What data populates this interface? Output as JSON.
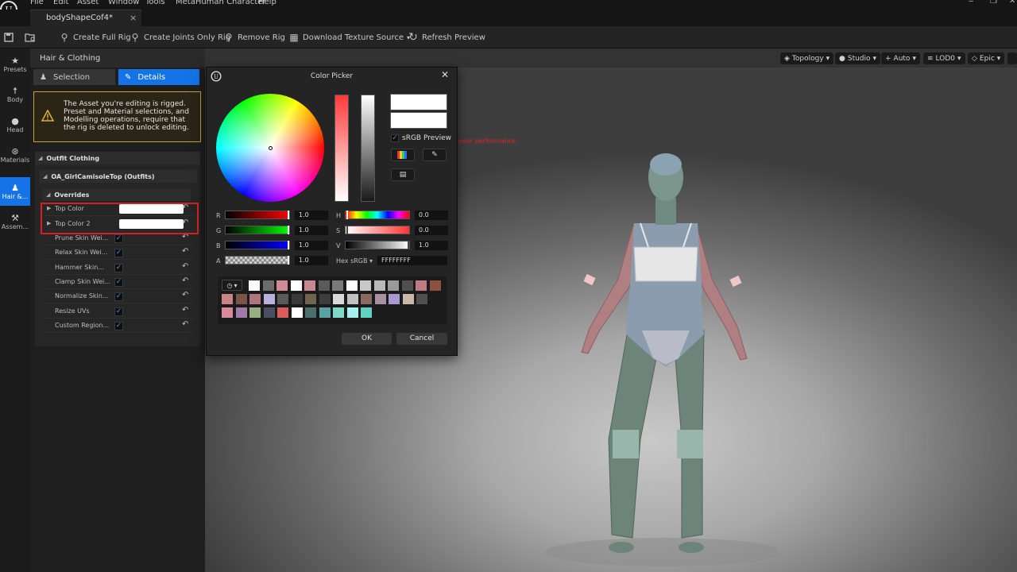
{
  "menu": [
    "File",
    "Edit",
    "Asset",
    "Window",
    "Tools",
    "MetaHuman Character",
    "Help"
  ],
  "tab": {
    "title": "bodyShapeCof4*",
    "close": "×"
  },
  "toolbar": {
    "create_full_rig": "Create Full Rig",
    "create_joints_rig": "Create Joints Only Rig",
    "remove_rig": "Remove Rig",
    "download_texture": "Download Texture Source",
    "refresh_preview": "Refresh Preview"
  },
  "rail": [
    {
      "label": "Presets",
      "icon": "star-icon"
    },
    {
      "label": "Body",
      "icon": "body-icon"
    },
    {
      "label": "Head",
      "icon": "head-icon"
    },
    {
      "label": "Materials",
      "icon": "materials-icon"
    },
    {
      "label": "Hair &...",
      "icon": "hair-icon"
    },
    {
      "label": "Assem...",
      "icon": "hammer-icon"
    }
  ],
  "panel": {
    "title": "Hair & Clothing",
    "seg_selection": "Selection",
    "seg_details": "Details",
    "warning": "The Asset you're editing is rigged. Preset and Material selections, and Modelling operations, require that the rig is deleted to unlock editing.",
    "section_outfit": "Outfit Clothing",
    "section_item": "OA_GirlCamisoleTop (Outfits)",
    "section_overrides": "Overrides",
    "props": [
      {
        "label": "Top Color",
        "kind": "color"
      },
      {
        "label": "Top Color 2",
        "kind": "color"
      },
      {
        "label": "Prune Skin Wei...",
        "kind": "check"
      },
      {
        "label": "Relax Skin Wei...",
        "kind": "check"
      },
      {
        "label": "Hammer Skin...",
        "kind": "check"
      },
      {
        "label": "Clamp Skin Wei...",
        "kind": "check"
      },
      {
        "label": "Normalize Skin...",
        "kind": "check"
      },
      {
        "label": "Resize UVs",
        "kind": "check"
      },
      {
        "label": "Custom Region...",
        "kind": "check"
      }
    ]
  },
  "viewport": {
    "topology": "Topology",
    "studio": "Studio",
    "auto": "Auto",
    "lod": "LOD0",
    "epic": "Epic",
    "perf_warning": "poor performance"
  },
  "picker": {
    "title": "Color Picker",
    "srgb": "sRGB Preview",
    "channels": {
      "r_label": "R",
      "r_value": "1.0",
      "g_label": "G",
      "g_value": "1.0",
      "b_label": "B",
      "b_value": "1.0",
      "a_label": "A",
      "a_value": "1.0",
      "h_label": "H",
      "h_value": "0.0",
      "s_label": "S",
      "s_value": "0.0",
      "v_label": "V",
      "v_value": "1.0"
    },
    "hex_label": "Hex sRGB",
    "hex_value": "FFFFFFFF",
    "ok": "OK",
    "cancel": "Cancel",
    "palette": [
      [
        "#ffffff",
        "#6c6c6c",
        "#cf8c95",
        "#ffffff",
        "#c98891",
        "#5a5a5a",
        "#7a7a7a",
        "#ffffff",
        "#c8c8c8",
        "#b9b9b9",
        "#9a9a9a",
        "#4f4f4f",
        "#c07a82",
        "#8a5040"
      ],
      [
        "#c98585",
        "#7a5548",
        "#b07580",
        "#b9b1dd",
        "#5a5a5a",
        "#3a3a3a",
        "#6f6450",
        "#3d3d3d",
        "#d9d9d9",
        "#c1c1c1",
        "#8a6a60",
        "#a790a0",
        "#a89ad0",
        "#cbb8a8",
        "#505050"
      ],
      [
        "#d98a99",
        "#a07aa8",
        "#9aac84",
        "#4a5060",
        "#d95c5c",
        "#ffffff",
        "#4a7070",
        "#5aa3a3",
        "#7fd9c8",
        "#a8f0f0",
        "#60d0c0"
      ]
    ]
  }
}
